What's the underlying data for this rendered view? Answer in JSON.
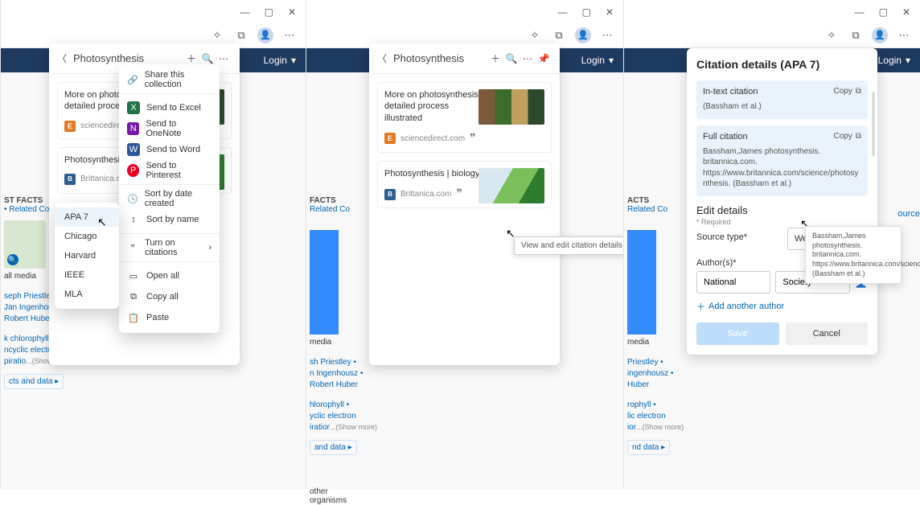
{
  "windowControls": {
    "min": "—",
    "max": "▢",
    "close": "✕"
  },
  "toolbar": {
    "collections_icon": "⧉",
    "more_icon": "⋯",
    "favorites_icon": "✧"
  },
  "navbar": {
    "login": "Login"
  },
  "sidebar": {
    "facts": "ST FACTS",
    "related": "Related Co",
    "media": "all media",
    "media2": "media",
    "authors": [
      "seph Priestley",
      "Jan Ingenhousz",
      "Robert Huber"
    ],
    "authors2": [
      "sh Priestley",
      "n Ingenhousz",
      "Robert Huber"
    ],
    "authors3": [
      "Priestley",
      "ingenhousz",
      "Huber"
    ],
    "chem": [
      "k chlorophyll",
      "ncyclic electron",
      "piratio"
    ],
    "chem2": [
      "hlorophyll",
      "yclic electron",
      "iratior"
    ],
    "chem3": [
      "rophyll",
      "lic electron",
      "ior"
    ],
    "more": "...(Show more)",
    "btn": "cts and data ▸",
    "btn2": "and data ▸",
    "btn3": "nd data ▸",
    "organisms": "other organisms"
  },
  "panel": {
    "title": "Photosynthesis",
    "card1": {
      "title": "More on photosynthesis – detailed process illustrated",
      "title_short": "More on photosynthesis",
      "title_short2": "detailed process illus",
      "src": "sciencedirect.com",
      "src_icon": "E"
    },
    "card2": {
      "title": "Photosynthesis | biology",
      "title_short": "Photosynthesis | biol",
      "src": "Brittanica.com",
      "src_icon": "B"
    }
  },
  "context": {
    "share": "Share this collection",
    "excel": "Send to Excel",
    "onenote": "Send to OneNote",
    "word": "Send to Word",
    "pinterest": "Send to Pinterest",
    "sort_date": "Sort by date created",
    "sort_name": "Sort by name",
    "citations": "Turn on citations",
    "open_all": "Open all",
    "copy_all": "Copy all",
    "paste": "Paste"
  },
  "styles": {
    "apa": "APA 7",
    "chicago": "Chicago",
    "harvard": "Harvard",
    "ieee": "IEEE",
    "mla": "MLA"
  },
  "tooltip": {
    "view_edit": "View and edit citation details"
  },
  "citation": {
    "title": "Citation details (APA 7)",
    "intext_lbl": "In-text citation",
    "copy": "Copy",
    "intext_body": "(Bassham et al.)",
    "full_lbl": "Full citation",
    "full_body": "Bassham,James photosynthesis. britannica.com. https://www.britannica.com/science/photosynthesis. (Bassham et al.)",
    "popover": "Bassham,James photosynthesis. britannica.com. https://www.britannica.com/science/photosynthesis. (Bassham et al.)",
    "edit": "Edit details",
    "required": "* Required",
    "source": "ource",
    "source_type_lbl": "Source type*",
    "source_type_val": "Website",
    "authors_lbl": "Author(s)*",
    "author_first": "National",
    "author_last": "Society",
    "add_author": "Add another author",
    "save": "Save",
    "cancel": "Cancel"
  },
  "headroom": {
    "facts2": "FACTS",
    "facts3": "ACTS"
  }
}
